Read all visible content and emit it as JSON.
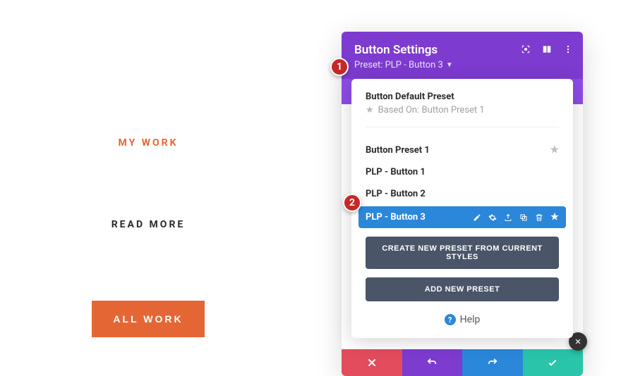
{
  "left": {
    "my_work": "MY WORK",
    "read_more": "READ MORE",
    "all_work": "ALL WORK"
  },
  "panel": {
    "title": "Button Settings",
    "preset_label": "Preset: PLP - Button 3"
  },
  "dropdown": {
    "default_preset": "Button Default Preset",
    "based_on": "Based On: Button Preset 1",
    "presets": [
      {
        "label": "Button Preset 1",
        "starred": true
      },
      {
        "label": "PLP - Button 1",
        "starred": false
      },
      {
        "label": "PLP - Button 2",
        "starred": false
      }
    ],
    "selected": "PLP - Button 3",
    "create_btn": "CREATE NEW PRESET FROM CURRENT STYLES",
    "add_btn": "ADD NEW PRESET",
    "help": "Help"
  },
  "markers": {
    "one": "1",
    "two": "2"
  },
  "colors": {
    "accent_orange": "#e56635",
    "purple": "#7e3bd0",
    "blue": "#2b87da",
    "green": "#29c4a9",
    "red": "#e24c5c"
  }
}
